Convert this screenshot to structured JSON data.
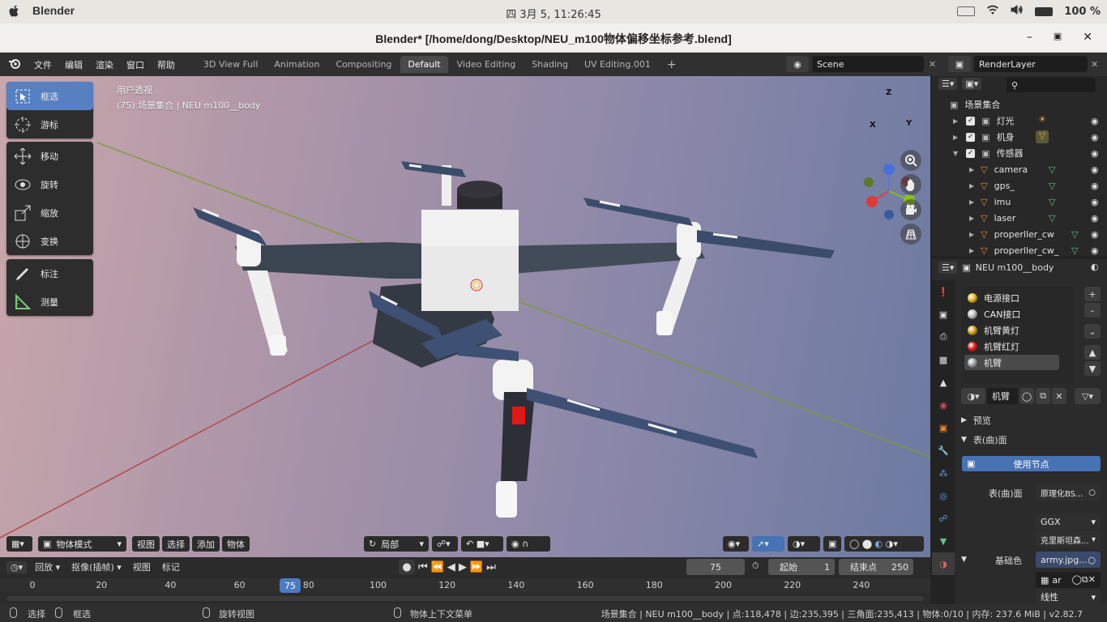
{
  "os_bar": {
    "app_name": "Blender",
    "clock": "四 3月  5, 11:26:45",
    "battery": "100 %"
  },
  "window": {
    "title": "Blender* [/home/dong/Desktop/NEU_m100物体偏移坐标参考.blend]"
  },
  "menubar": {
    "items": [
      "文件",
      "编辑",
      "渲染",
      "窗口",
      "帮助"
    ],
    "tabs": [
      "3D View Full",
      "Animation",
      "Compositing",
      "Default",
      "Video Editing",
      "Shading",
      "UV Editing.001"
    ],
    "active_tab": "Default",
    "scene": "Scene",
    "render_layer": "RenderLayer"
  },
  "toolbar": {
    "tools": [
      "框选",
      "游标",
      "移动",
      "旋转",
      "缩放",
      "变换",
      "标注",
      "测量"
    ]
  },
  "viewport": {
    "view_name": "用户透视",
    "collection_info": "(75) 场景集合 | NEU m100__body",
    "gizmo": {
      "x": "X",
      "y": "Y",
      "z": "Z"
    }
  },
  "vp_header": {
    "mode": "物体模式",
    "menus": [
      "视图",
      "选择",
      "添加",
      "物体"
    ],
    "pivot": "局部"
  },
  "timeline": {
    "playback": "回放",
    "keying": "抠像(插帧)",
    "view": "视图",
    "marker": "标记",
    "current_frame": "75",
    "start_label": "起始",
    "start": "1",
    "end_label": "结束点",
    "end": "250",
    "ticks": [
      "0",
      "20",
      "40",
      "60",
      "80",
      "100",
      "120",
      "140",
      "160",
      "180",
      "200",
      "220",
      "240"
    ]
  },
  "status": {
    "select": "选择",
    "box_select": "框选",
    "rotate_view": "旋转视图",
    "context_menu": "物体上下文菜单",
    "stats": "场景集合 | NEU m100__body | 点:118,478 | 边:235,395 | 三角面:235,413 | 物体:0/10 | 内存: 237.6 MiB | v2.82.7"
  },
  "outliner": {
    "root": "场景集合",
    "rows": [
      {
        "name": "灯光",
        "level": 1
      },
      {
        "name": "机身",
        "level": 1
      },
      {
        "name": "传感器",
        "level": 1
      },
      {
        "name": "camera",
        "level": 2
      },
      {
        "name": "gps_",
        "level": 2
      },
      {
        "name": "imu",
        "level": 2
      },
      {
        "name": "laser",
        "level": 2
      },
      {
        "name": "properller_cw",
        "level": 2
      },
      {
        "name": "properller_cw_",
        "level": 2
      }
    ]
  },
  "properties": {
    "object_name": "NEU m100__body",
    "materials": [
      {
        "name": "电源接口",
        "color": "#e8b21c"
      },
      {
        "name": "CAN接口",
        "color": "#bdbdbd"
      },
      {
        "name": "机臂黄灯",
        "color": "#d4a017"
      },
      {
        "name": "机臂红灯",
        "color": "#e01818"
      },
      {
        "name": "机臂",
        "color": "#9aa0a8"
      }
    ],
    "active_material": "机臂",
    "preview": "预览",
    "surface_section": "表(曲)面",
    "use_nodes": "使用节点",
    "surface_label": "表(曲)面",
    "surface_value": "原理化BS...",
    "distribution": "GGX",
    "subsurface": "克里斯坦森...",
    "base_color_label": "基础色",
    "base_color_value": "army.jpg...",
    "image_short": "ar",
    "interpolation": "线性"
  }
}
